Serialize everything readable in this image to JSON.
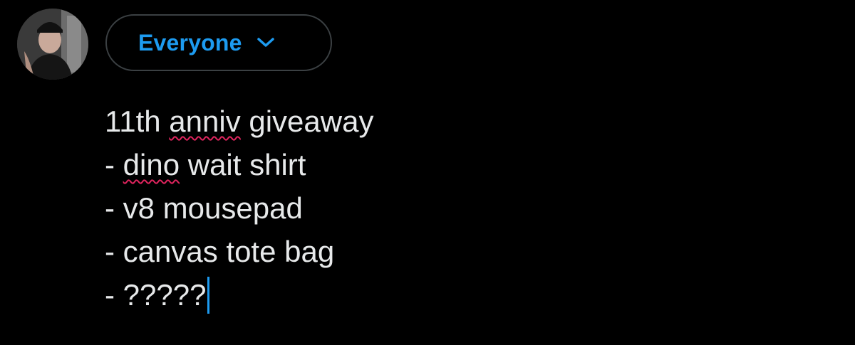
{
  "audience": {
    "label": "Everyone"
  },
  "icons": {
    "audience_chevron": "chevron-down-icon",
    "avatar": "profile-photo"
  },
  "compose": {
    "line1_a": "11th ",
    "line1_misspelled": "anniv",
    "line1_b": " giveaway",
    "line2_a": "- ",
    "line2_misspelled": "dino",
    "line2_b": " wait shirt",
    "line3": "- v8 mousepad",
    "line4": "- canvas tote bag",
    "line5": "- ?????"
  },
  "colors": {
    "accent": "#1d9bf0",
    "background": "#000000",
    "text": "#e7e9ea",
    "border": "#3b4043",
    "spellcheck": "#e0245e"
  }
}
